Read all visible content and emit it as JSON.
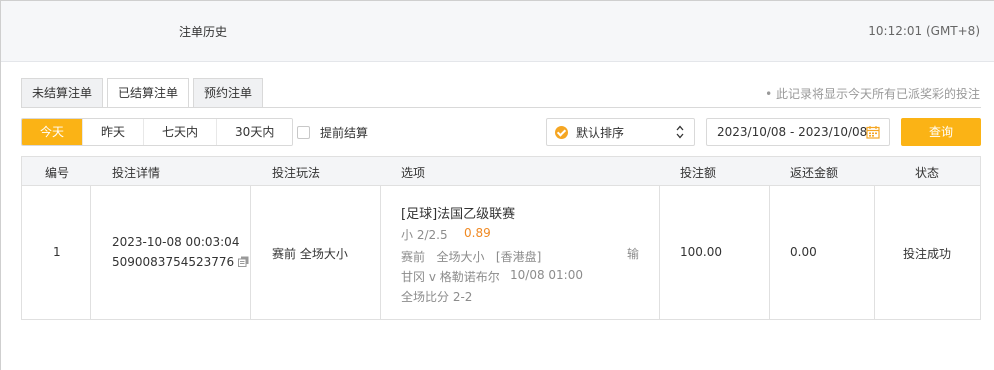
{
  "header": {
    "title": "注单历史",
    "clock": "10:12:01 (GMT+8)"
  },
  "tabs": [
    {
      "label": "未结算注单",
      "active": false
    },
    {
      "label": "已结算注单",
      "active": true
    },
    {
      "label": "预约注单",
      "active": false
    }
  ],
  "notice": "• 此记录将显示今天所有已派奖彩的投注",
  "filters": {
    "ranges": [
      {
        "label": "今天",
        "active": true
      },
      {
        "label": "昨天",
        "active": false
      },
      {
        "label": "七天内",
        "active": false
      },
      {
        "label": "30天内",
        "active": false
      }
    ],
    "early_settle_label": "提前结算",
    "early_settle_checked": false,
    "sort_label": "默认排序",
    "date_range": "2023/10/08 - 2023/10/08",
    "query_label": "查询"
  },
  "colors": {
    "accent": "#fbb315",
    "odds": "#f08a24",
    "sort_icon": "#f5a623"
  },
  "table": {
    "columns": [
      "编号",
      "投注详情",
      "投注玩法",
      "选项",
      "投注额",
      "返还金额",
      "状态"
    ],
    "rows": [
      {
        "index": "1",
        "datetime": "2023-10-08 00:03:04",
        "ticket": "5090083754523776",
        "play": "赛前 全场大小",
        "league": "[足球]法国乙级联赛",
        "selection": "小 2/2.5",
        "odds": "0.89",
        "market": "赛前   全场大小   [香港盘]",
        "result": "输",
        "match": "甘冈 v 格勒诺布尔",
        "kickoff": "10/08 01:00",
        "score": "全场比分 2-2",
        "stake": "100.00",
        "return": "0.00",
        "status": "投注成功"
      }
    ]
  }
}
